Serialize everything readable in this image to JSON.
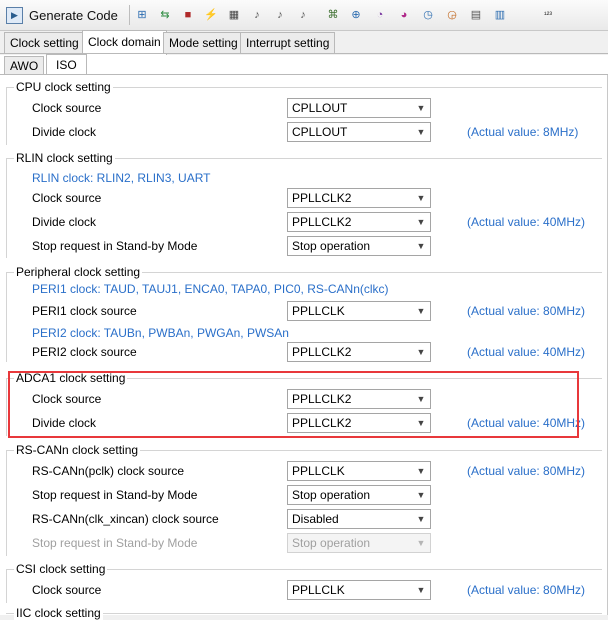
{
  "toolbar": {
    "generate_label": "Generate Code",
    "icons": [
      {
        "name": "pin-config-icon",
        "glyph": "⊞",
        "color": "#2b6cb0"
      },
      {
        "name": "port-icon",
        "glyph": "⇆",
        "color": "#2b8a3e"
      },
      {
        "name": "chip-icon",
        "glyph": "■",
        "color": "#b02a2a"
      },
      {
        "name": "interrupt-icon",
        "glyph": "⚡",
        "color": "#2b8a3e"
      },
      {
        "name": "timer-icon",
        "glyph": "▦",
        "color": "#444444"
      },
      {
        "name": "serial-icon",
        "glyph": "♪",
        "color": "#555555"
      },
      {
        "name": "serial2-icon",
        "glyph": "♪",
        "color": "#555555"
      },
      {
        "name": "serial3-icon",
        "glyph": "♪",
        "color": "#555555"
      },
      {
        "name": "network-icon",
        "glyph": "⌘",
        "color": "#3c6e2e"
      },
      {
        "name": "dma-icon",
        "glyph": "⊕",
        "color": "#2b6cb0"
      },
      {
        "name": "clock-icon",
        "glyph": "◔",
        "color": "#7a3aa0"
      },
      {
        "name": "clock2-icon",
        "glyph": "◕",
        "color": "#b02a8a"
      },
      {
        "name": "watchdog-icon",
        "glyph": "◷",
        "color": "#2b6cb0"
      },
      {
        "name": "rtc-icon",
        "glyph": "◶",
        "color": "#c0641a"
      },
      {
        "name": "table-icon",
        "glyph": "▤",
        "color": "#555555"
      },
      {
        "name": "grid-icon",
        "glyph": "▥",
        "color": "#2b6cb0"
      },
      {
        "name": "counter-icon",
        "glyph": "¹²³",
        "color": "#333333"
      }
    ]
  },
  "tabs": [
    "Clock setting",
    "Clock domain",
    "Mode setting",
    "Interrupt setting"
  ],
  "subtabs": [
    "AWO",
    "ISO"
  ],
  "groups": {
    "cpu": {
      "title": "CPU clock setting"
    },
    "rlin": {
      "title": "RLIN clock setting",
      "note": "RLIN clock: RLIN2, RLIN3, UART"
    },
    "peri": {
      "title": "Peripheral clock setting",
      "note1": "PERI1 clock: TAUD, TAUJ1, ENCA0, TAPA0, PIC0, RS-CANn(clkc)",
      "note2": "PERI2 clock: TAUBn, PWBAn, PWGAn, PWSAn"
    },
    "adca": {
      "title": "ADCA1 clock setting"
    },
    "rscan": {
      "title": "RS-CANn clock setting"
    },
    "csi": {
      "title": "CSI clock setting"
    },
    "iic": {
      "title": "IIC clock setting"
    }
  },
  "rows": {
    "cpu_src": {
      "label": "Clock source",
      "value": "CPLLOUT"
    },
    "cpu_div": {
      "label": "Divide clock",
      "value": "CPLLOUT",
      "actual": "(Actual value: 8MHz)"
    },
    "rlin_src": {
      "label": "Clock source",
      "value": "PPLLCLK2"
    },
    "rlin_div": {
      "label": "Divide clock",
      "value": "PPLLCLK2",
      "actual": "(Actual value: 40MHz)"
    },
    "rlin_stop": {
      "label": "Stop request in Stand-by Mode",
      "value": "Stop operation"
    },
    "peri1": {
      "label": "PERI1 clock source",
      "value": "PPLLCLK",
      "actual": "(Actual value: 80MHz)"
    },
    "peri2": {
      "label": "PERI2 clock source",
      "value": "PPLLCLK2",
      "actual": "(Actual value: 40MHz)"
    },
    "adca_src": {
      "label": "Clock source",
      "value": "PPLLCLK2"
    },
    "adca_div": {
      "label": "Divide clock",
      "value": "PPLLCLK2",
      "actual": "(Actual value: 40MHz)"
    },
    "rscan_pclk": {
      "label": "RS-CANn(pclk) clock source",
      "value": "PPLLCLK",
      "actual": "(Actual value: 80MHz)"
    },
    "rscan_stop": {
      "label": "Stop request in Stand-by Mode",
      "value": "Stop operation"
    },
    "rscan_xin": {
      "label": "RS-CANn(clk_xincan) clock source",
      "value": "Disabled"
    },
    "rscan_stop2": {
      "label": "Stop request in Stand-by Mode",
      "value": "Stop operation"
    },
    "csi_src": {
      "label": "Clock source",
      "value": "PPLLCLK",
      "actual": "(Actual value: 80MHz)"
    }
  },
  "arrow_glyph": "▼"
}
